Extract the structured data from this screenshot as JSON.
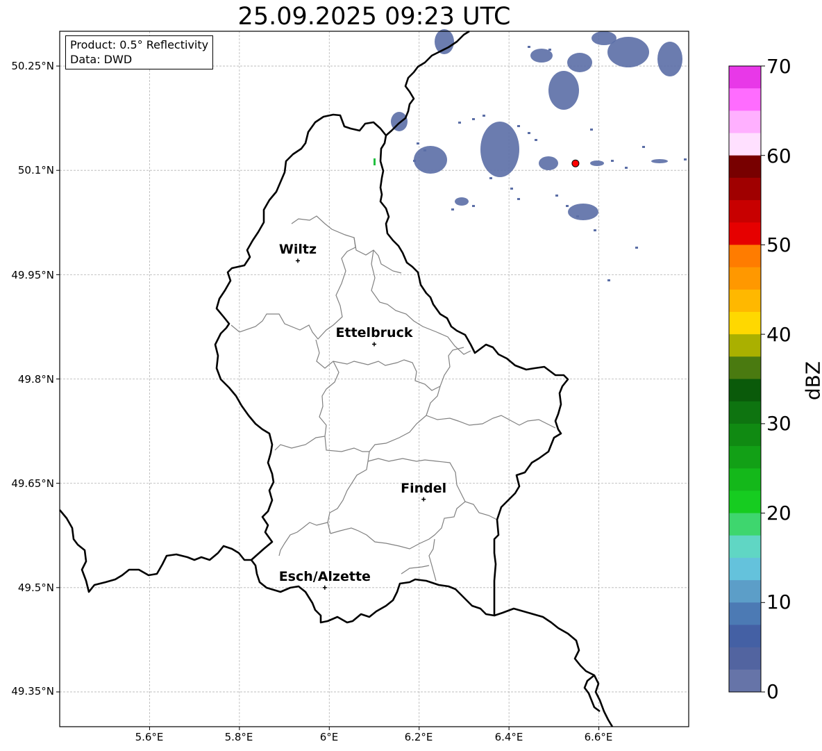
{
  "title": "25.09.2025 09:23 UTC",
  "info_box": {
    "product": "Product: 0.5° Reflectivity",
    "data_source": "Data: DWD"
  },
  "map": {
    "extent": {
      "lon_min": 5.4,
      "lon_max": 6.8,
      "lat_min": 49.3,
      "lat_max": 50.3
    },
    "x_ticks": [
      "5.6°E",
      "5.8°E",
      "6°E",
      "6.2°E",
      "6.4°E",
      "6.6°E"
    ],
    "y_ticks": [
      "50.25°N",
      "50.1°N",
      "49.95°N",
      "49.8°N",
      "49.65°N",
      "49.5°N",
      "49.35°N"
    ],
    "grid": true,
    "cities": [
      {
        "name": "Wiltz",
        "lon": 5.93,
        "lat": 49.97
      },
      {
        "name": "Ettelbruck",
        "lon": 6.1,
        "lat": 49.85
      },
      {
        "name": "Findel",
        "lon": 6.21,
        "lat": 49.627
      },
      {
        "name": "Esch/Alzette",
        "lon": 5.99,
        "lat": 49.5
      }
    ],
    "radar_site": {
      "lon": 6.548,
      "lat": 50.11,
      "color": "#ff0000"
    },
    "precipitation_color": "#5b6ea6"
  },
  "colorbar": {
    "label": "dBZ",
    "min": 0,
    "max": 70,
    "tick_values": [
      "70",
      "60",
      "50",
      "40",
      "30",
      "20",
      "10",
      "0"
    ],
    "colors_top_to_bottom": [
      "#e838e8",
      "#ff6cff",
      "#ffb0ff",
      "#ffe0ff",
      "#780000",
      "#a00000",
      "#c80000",
      "#e60000",
      "#ff7c00",
      "#ff9800",
      "#ffb800",
      "#ffd800",
      "#aab000",
      "#4a7a10",
      "#0a5a0a",
      "#0e7410",
      "#108a12",
      "#12a016",
      "#14b81a",
      "#16cc20",
      "#3ed66e",
      "#60d6c4",
      "#64c2dc",
      "#5c9ec8",
      "#4c7ab4",
      "#4460a4",
      "#5264a0",
      "#6674a8"
    ]
  }
}
